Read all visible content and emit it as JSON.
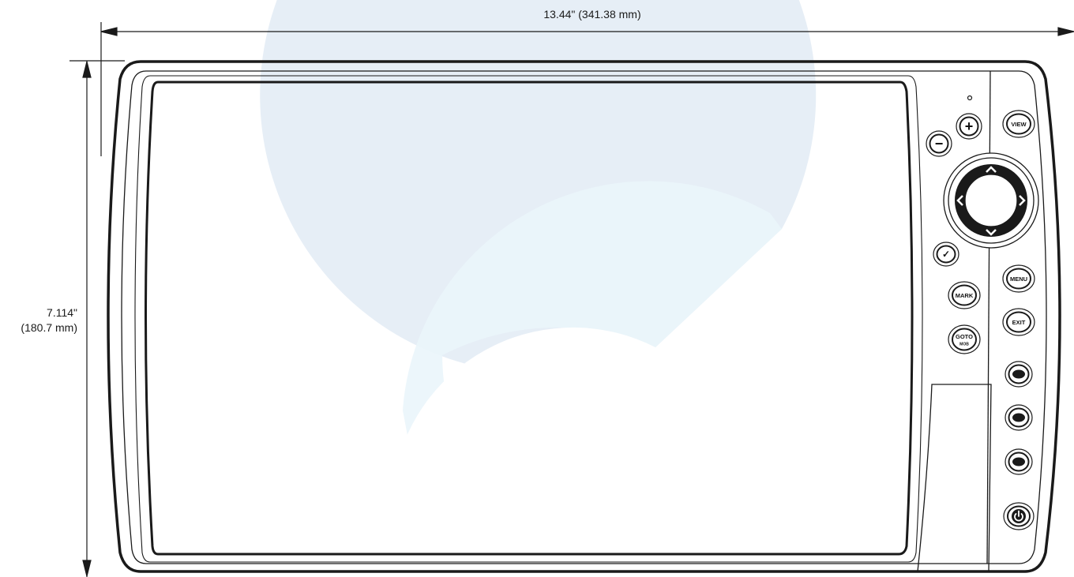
{
  "dimensions": {
    "width_label": "13.44\" (341.38 mm)",
    "height_line_1": "7.114\"",
    "height_line_2": "(180.7 mm)"
  },
  "buttons": {
    "view": "VIEW",
    "menu": "MENU",
    "exit": "EXIT",
    "mark": "MARK",
    "goto": "GOTO",
    "mob": "MOB",
    "zoom_in": "+",
    "zoom_out": "−",
    "check": "✓"
  },
  "icons": {
    "up": "chevron-up-icon",
    "down": "chevron-down-icon",
    "left": "chevron-left-icon",
    "right": "chevron-right-icon",
    "power": "power-icon",
    "check": "check-icon",
    "light_sensor": "light-sensor-icon"
  },
  "colors": {
    "outline": "#1a1a1a",
    "watermark_outer": "#e6eef6",
    "watermark_inner": "#eaf5fb",
    "background": "#ffffff"
  }
}
